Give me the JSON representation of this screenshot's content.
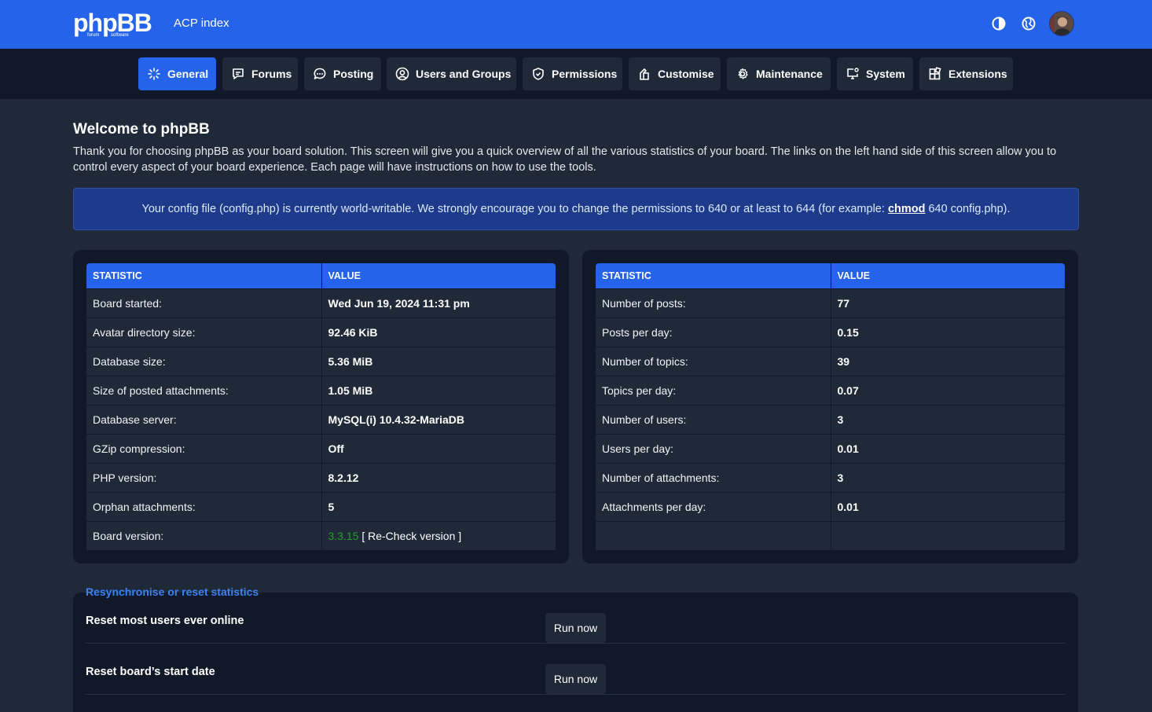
{
  "header": {
    "logo_text": "phpBB",
    "logo_subtext": "forum software",
    "title": "ACP index",
    "icons": [
      "theme-toggle-icon",
      "globe-icon"
    ]
  },
  "nav": {
    "tabs": [
      {
        "label": "General",
        "icon": "sparkle-icon",
        "active": true
      },
      {
        "label": "Forums",
        "icon": "chat-bubble-icon"
      },
      {
        "label": "Posting",
        "icon": "comment-icon"
      },
      {
        "label": "Users and Groups",
        "icon": "user-circle-icon"
      },
      {
        "label": "Permissions",
        "icon": "shield-icon"
      },
      {
        "label": "Customise",
        "icon": "puzzle-icon"
      },
      {
        "label": "Maintenance",
        "icon": "gear-icon"
      },
      {
        "label": "System",
        "icon": "monitor-gear-icon"
      },
      {
        "label": "Extensions",
        "icon": "blocks-icon"
      }
    ]
  },
  "welcome": {
    "title": "Welcome to phpBB",
    "text": "Thank you for choosing phpBB as your board solution. This screen will give you a quick overview of all the various statistics of your board. The links on the left hand side of this screen allow you to control every aspect of your board experience. Each page will have instructions on how to use the tools."
  },
  "notice": {
    "before": "Your config file (config.php) is currently world-writable. We strongly encourage you to change the permissions to 640 or at least to 644 (for example: ",
    "link": "chmod",
    "after": " 640 config.php)."
  },
  "stats_left": {
    "headers": [
      "STATISTIC",
      "VALUE"
    ],
    "rows": [
      {
        "label": "Board started:",
        "value": "Wed Jun 19, 2024 11:31 pm"
      },
      {
        "label": "Avatar directory size:",
        "value": "92.46 KiB"
      },
      {
        "label": "Database size:",
        "value": "5.36 MiB"
      },
      {
        "label": "Size of posted attachments:",
        "value": "1.05 MiB"
      },
      {
        "label": "Database server:",
        "value": "MySQL(i) 10.4.32-MariaDB"
      },
      {
        "label": "GZip compression:",
        "value": "Off"
      },
      {
        "label": "PHP version:",
        "value": "8.2.12"
      },
      {
        "label": "Orphan attachments:",
        "value": "5"
      }
    ],
    "version_label": "Board version:",
    "version_value": "3.3.15",
    "version_color": "#22a02c",
    "recheck": "[ Re-Check version ]"
  },
  "stats_right": {
    "headers": [
      "STATISTIC",
      "VALUE"
    ],
    "rows": [
      {
        "label": "Number of posts:",
        "value": "77"
      },
      {
        "label": "Posts per day:",
        "value": "0.15"
      },
      {
        "label": "Number of topics:",
        "value": "39"
      },
      {
        "label": "Topics per day:",
        "value": "0.07"
      },
      {
        "label": "Number of users:",
        "value": "3"
      },
      {
        "label": "Users per day:",
        "value": "0.01"
      },
      {
        "label": "Number of attachments:",
        "value": "3"
      },
      {
        "label": "Attachments per day:",
        "value": "0.01"
      }
    ]
  },
  "resync": {
    "legend": "Resynchronise or reset statistics",
    "rows": [
      {
        "label": "Reset most users ever online",
        "button": "Run now"
      },
      {
        "label": "Reset board’s start date",
        "button": "Run now"
      }
    ]
  },
  "colors": {
    "accent": "#2563eb",
    "background": "#1f2937",
    "panel": "#111827",
    "notice": "#1e3a8a"
  }
}
